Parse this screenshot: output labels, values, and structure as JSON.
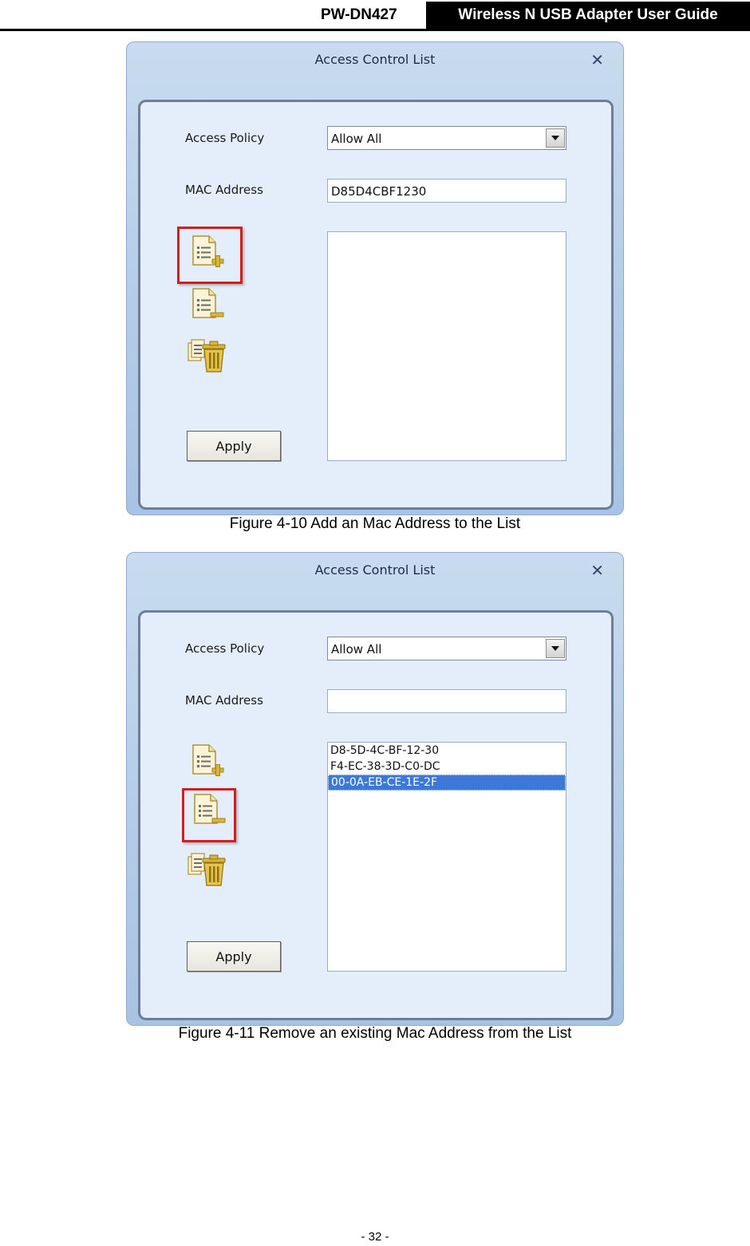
{
  "header": {
    "model": "PW-DN427",
    "title": "Wireless N USB Adapter User Guide"
  },
  "figures": [
    {
      "dialog_title": "Access Control List",
      "close_glyph": "✕",
      "policy_label": "Access Policy",
      "policy_value": "Allow All",
      "mac_label": "MAC Address",
      "mac_value": "D85D4CBF1230",
      "list_items": [],
      "apply_label": "Apply",
      "highlighted_icon": "add-entry-icon",
      "caption": "Figure 4-10 Add an Mac Address to the List"
    },
    {
      "dialog_title": "Access Control List",
      "close_glyph": "✕",
      "policy_label": "Access Policy",
      "policy_value": "Allow All",
      "mac_label": "MAC Address",
      "mac_value": "",
      "list_items": [
        "D8-5D-4C-BF-12-30",
        "F4-EC-38-3D-C0-DC",
        "00-0A-EB-CE-1E-2F"
      ],
      "selected_index": 2,
      "apply_label": "Apply",
      "highlighted_icon": "remove-entry-icon",
      "caption": "Figure 4-11 Remove an existing Mac Address from the List"
    }
  ],
  "page_number": "- 32 -",
  "colors": {
    "highlight": "#d61d1d",
    "selection": "#3b78d8",
    "icon_gold": "#d9b53a"
  }
}
